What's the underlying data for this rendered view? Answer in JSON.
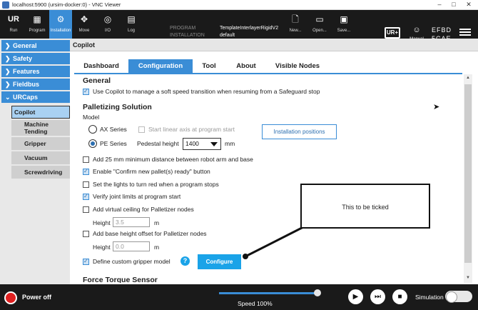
{
  "window": {
    "title": "localhost:5900 (ursim-docker:0) - VNC Viewer"
  },
  "topbar": {
    "buttons": [
      {
        "label": "Run"
      },
      {
        "label": "Program"
      },
      {
        "label": "Installation"
      },
      {
        "label": "Move"
      },
      {
        "label": "I/O"
      },
      {
        "label": "Log"
      }
    ],
    "program_label": "PROGRAM",
    "program_value": "TemplateInterlayerRigidV2",
    "installation_label": "INSTALLATION",
    "installation_value": "default",
    "file_buttons": [
      {
        "label": "New..."
      },
      {
        "label": "Open..."
      },
      {
        "label": "Save..."
      }
    ],
    "mode_label": "Manual",
    "robot_id_line1": "EFBD",
    "robot_id_line2": "5CAE"
  },
  "sidebar": {
    "items": [
      {
        "label": "General"
      },
      {
        "label": "Safety"
      },
      {
        "label": "Features"
      },
      {
        "label": "Fieldbus"
      },
      {
        "label": "URCaps"
      }
    ],
    "subitems": [
      {
        "label": "Copilot"
      },
      {
        "label": "Machine Tending"
      },
      {
        "label": "Gripper"
      },
      {
        "label": "Vacuum"
      },
      {
        "label": "Screwdriving"
      }
    ]
  },
  "content": {
    "header": "Copilot",
    "tabs": [
      {
        "label": "Dashboard"
      },
      {
        "label": "Configuration"
      },
      {
        "label": "Tool"
      },
      {
        "label": "About"
      },
      {
        "label": "Visible Nodes"
      }
    ],
    "general_heading": "General",
    "general_option": "Use Copilot to manage a soft speed transition when resuming from a Safeguard stop",
    "palletizing_heading": "Palletizing Solution",
    "model_label": "Model",
    "radio_ax": "AX Series",
    "start_linear": "Start linear axis at program start",
    "installation_positions": "Installation positions",
    "radio_pe": "PE Series",
    "pedestal_label": "Pedestal height",
    "pedestal_value": "1400",
    "pedestal_unit": "mm",
    "options": [
      {
        "label": "Add 25 mm minimum distance between robot arm and base",
        "checked": false
      },
      {
        "label": "Enable \"Confirm new pallet(s) ready\" button",
        "checked": true
      },
      {
        "label": "Set the lights to turn red when a program stops",
        "checked": false
      },
      {
        "label": "Verify joint limits at program start",
        "checked": true
      },
      {
        "label": "Add virtual ceiling for Palletizer nodes",
        "checked": false
      }
    ],
    "height_label": "Height",
    "ceiling_height": "3.5",
    "ceiling_unit": "m",
    "base_offset_label": "Add base height offset for Palletizer nodes",
    "base_height": "0.0",
    "base_unit": "m",
    "gripper_label": "Define custom gripper model",
    "configure_label": "Configure",
    "force_heading": "Force Torque Sensor"
  },
  "callout": {
    "text": "This to be ticked"
  },
  "bottombar": {
    "power_label": "Power off",
    "speed_label": "Speed 100%",
    "speed_percent": 100,
    "simulation_label": "Simulation"
  }
}
